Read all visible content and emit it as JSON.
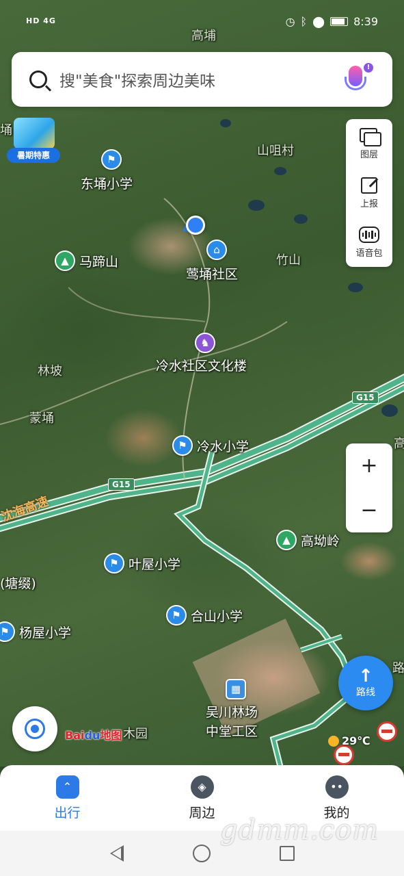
{
  "status_bar": {
    "network": "HD 4G",
    "time": "8:39"
  },
  "search": {
    "placeholder": "搜\"美食\"探索周边美味"
  },
  "promo": {
    "label": "暑期特惠"
  },
  "toolbar": {
    "layers_label": "图层",
    "report_label": "上报",
    "voice_label": "语音包"
  },
  "zoom": {
    "in_label": "+",
    "out_label": "−"
  },
  "route": {
    "label": "路线"
  },
  "map": {
    "places": {
      "gaojing": "高埔",
      "shanjiecun": "山咀村",
      "zhushan": "竹山",
      "linpo": "林坡",
      "mengyong": "蒙埇",
      "tangzhui": "(塘缀)",
      "mumian": "木园",
      "tong_edge": "埇",
      "gao_edge": "高",
      "lu_edge": "路"
    },
    "pois": {
      "dongyong": "东埇小学",
      "matishan": "马蹄山",
      "yingyong": "莺埇社区",
      "lengshui_culture": "冷水社区文化楼",
      "lengshui_school": "冷水小学",
      "yewu_school": "叶屋小学",
      "heshan_school": "合山小学",
      "yangwu_school": "杨屋小学",
      "gaoaoling": "高坳岭",
      "wuchuan_line1": "吴川林场",
      "wuchuan_line2": "中堂工区"
    },
    "highway": {
      "badge": "G15",
      "name": "沈海高速"
    }
  },
  "logo": {
    "brand": "Bai",
    "paw": "du",
    "suffix": "地图"
  },
  "weather": {
    "temperature": "29℃"
  },
  "tabs": [
    {
      "label": "出行",
      "active": true
    },
    {
      "label": "周边",
      "active": false
    },
    {
      "label": "我的",
      "active": false
    }
  ],
  "watermark": "gdmm.com",
  "colors": {
    "accent": "#2b7ae8",
    "highway": "#3b8e5c"
  }
}
